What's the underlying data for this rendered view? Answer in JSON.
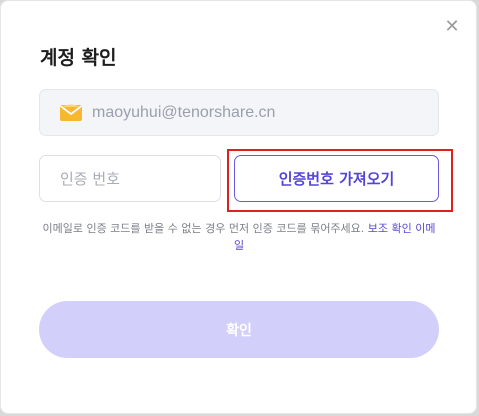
{
  "dialog": {
    "title": "계정 확인",
    "close_icon": "close-icon",
    "close_glyph": "✕"
  },
  "email": {
    "icon": "envelope-icon",
    "value": "maoyuhui@tenorshare.cn"
  },
  "code": {
    "placeholder": "인증 번호",
    "value": ""
  },
  "get_code_button": {
    "label": "인증번호 가져오기"
  },
  "notice": {
    "text": "이메일로 인증 코드를 받을 수 없는 경우 먼저 인증 코드를 묶어주세요.",
    "link_label": "보조 확인 이메일"
  },
  "confirm_button": {
    "label": "확인"
  },
  "colors": {
    "accent": "#5445d6",
    "confirm_disabled": "#d3cffb",
    "highlight_border": "#e0201e",
    "envelope": "#f5b82e"
  }
}
